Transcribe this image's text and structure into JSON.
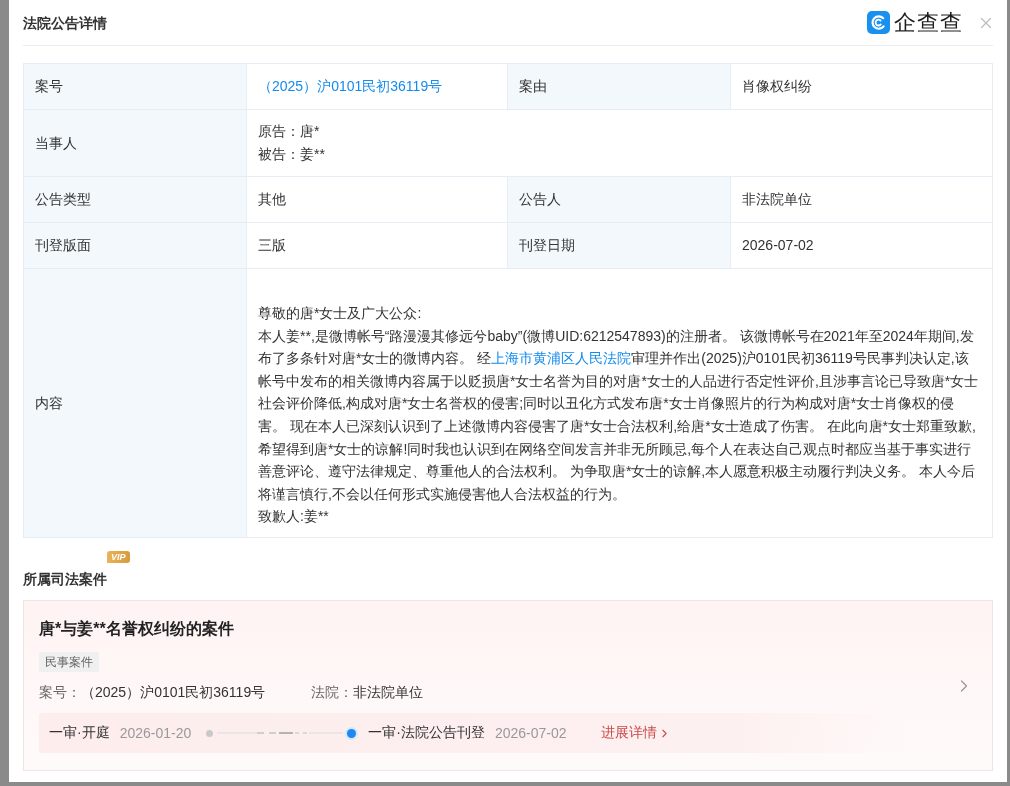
{
  "dialog": {
    "title": "法院公告详情",
    "brand": "企查查"
  },
  "details": [
    {
      "kind": "pair",
      "fields": [
        {
          "label": "案号",
          "value": "（2025）沪0101民初36119号",
          "kind": "link"
        },
        {
          "label": "案由",
          "value": "肖像权纠纷",
          "kind": "text"
        }
      ]
    },
    {
      "kind": "lines",
      "label": "当事人",
      "lines": [
        "原告：唐*",
        "被告：姜**"
      ]
    },
    {
      "kind": "pair",
      "fields": [
        {
          "label": "公告类型",
          "value": "其他",
          "kind": "text"
        },
        {
          "label": "公告人",
          "value": "非法院单位",
          "kind": "text"
        }
      ]
    },
    {
      "kind": "pair",
      "fields": [
        {
          "label": "刊登版面",
          "value": "三版",
          "kind": "text"
        },
        {
          "label": "刊登日期",
          "value": "2026-07-02",
          "kind": "text"
        }
      ]
    },
    {
      "kind": "content",
      "label": "内容",
      "salutation": "尊敬的唐*女士及广大公众:",
      "body": [
        {
          "kind": "text",
          "text": "本人姜**,是微博帐号“路漫漫其修远兮baby”(微博UID:6212547893)的注册者。 该微博帐号在2021年至2024年期间,发布了多条针对唐*女士的微博内容。 经"
        },
        {
          "kind": "link",
          "text": "上海市黄浦区人民法院"
        },
        {
          "kind": "text",
          "text": "审理并作出(2025)沪0101民初36119号民事判决认定,该帐号中发布的相关微博内容属于以贬损唐*女士名誉为目的对唐*女士的人品进行否定性评价,且涉事言论已导致唐*女士社会评价降低,构成对唐*女士名誉权的侵害;同时以丑化方式发布唐*女士肖像照片的行为构成对唐*女士肖像权的侵害。 现在本人已深刻认识到了上述微博内容侵害了唐*女士合法权利,给唐*女士造成了伤害。 在此向唐*女士郑重致歉,希望得到唐*女士的谅解!同时我也认识到在网络空间发言并非无所顾忌,每个人在表达自己观点时都应当基于事实进行善意评论、遵守法律规定、尊重他人的合法权利。 为争取唐*女士的谅解,本人愿意积极主动履行判决义务。 本人今后将谨言慎行,不会以任何形式实施侵害他人合法权益的行为。"
        }
      ],
      "signature": "致歉人:姜**"
    }
  ],
  "related": {
    "title": "所属司法案件",
    "badge": "VIP",
    "cases": [
      {
        "title": "唐*与姜**名誉权纠纷的案件",
        "tag": "民事案件",
        "fields": [
          {
            "label": "案号：",
            "value": "（2025）沪0101民初36119号"
          },
          {
            "label": "法院：",
            "value": "非法院单位"
          }
        ],
        "timeline": [
          {
            "stage": "一审·开庭",
            "date": "2026-01-20",
            "current": false
          },
          {
            "stage": "一审·法院公告刊登",
            "date": "2026-07-02",
            "current": true
          }
        ],
        "details_link": "进展详情"
      }
    ]
  }
}
